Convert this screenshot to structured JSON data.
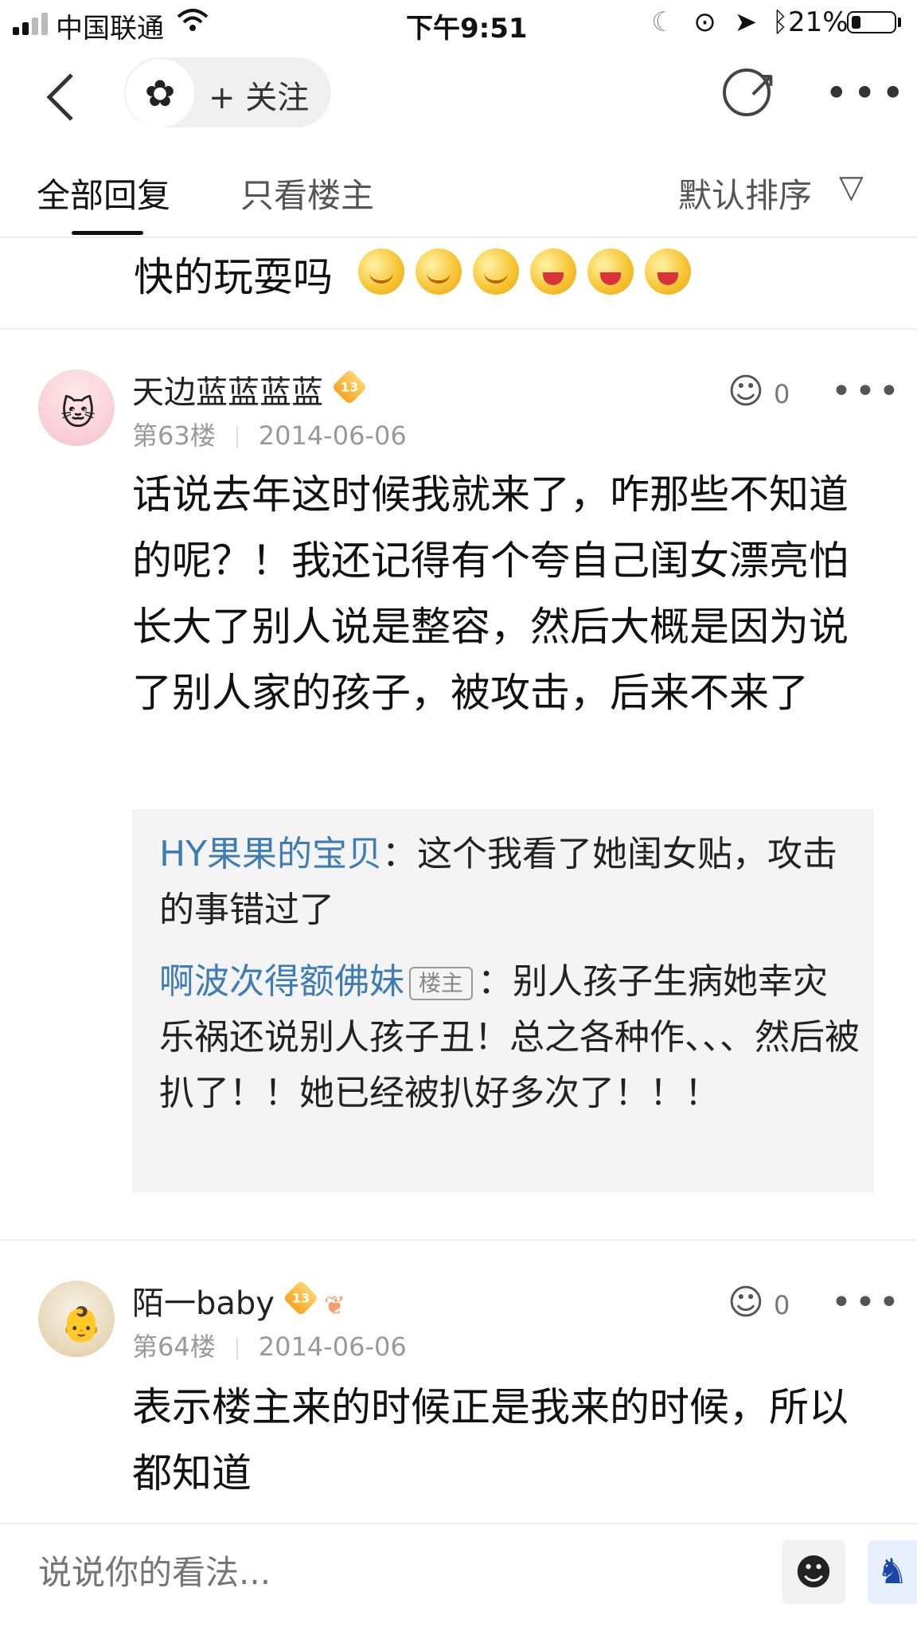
{
  "status_bar": {
    "carrier": "中国联通",
    "time": "下午9:51",
    "battery_percent": "21%",
    "battery_level": 0.21,
    "icons": [
      "moon-icon",
      "orientation-lock-icon",
      "location-icon",
      "bluetooth-icon"
    ]
  },
  "nav": {
    "back_icon": "chevron-left-icon",
    "follow_label": "+ 关注",
    "share_icon": "share-icon",
    "more_icon": "more-icon"
  },
  "tabs": {
    "all_replies": "全部回复",
    "owner_only": "只看楼主",
    "sort_label": "默认排序",
    "filter_icon": "filter-icon"
  },
  "previous_post": {
    "tail_text": "快的玩耍吗",
    "emojis": [
      "smile-emoji",
      "smile-emoji",
      "smile-emoji",
      "laugh-emoji",
      "laugh-emoji",
      "laugh-emoji"
    ]
  },
  "posts": [
    {
      "username": "天边蓝蓝蓝蓝",
      "level": "13",
      "floor": "第63楼",
      "date": "2014-06-06",
      "likes": "0",
      "content": "话说去年这时候我就来了，咋那些不知道的呢？！我还记得有个夸自己闺女漂亮怕长大了别人说是整容，然后大概是因为说了别人家的孩子，被攻击，后来不来了",
      "replies": [
        {
          "user": "HY果果的宝贝",
          "tag": "",
          "separator": "：",
          "text": "这个我看了她闺女贴，攻击的事错过了"
        },
        {
          "user": "啊波次得额佛妹",
          "tag": "楼主",
          "separator": "：",
          "text": "别人孩子生病她幸灾乐祸还说别人孩子丑！总之各种作、、、然后被扒了！！她已经被扒好多次了！！！"
        }
      ]
    },
    {
      "username": "陌一baby",
      "level": "13",
      "floor": "第64楼",
      "date": "2014-06-06",
      "likes": "0",
      "content": "表示楼主来的时候正是我来的时候，所以都知道"
    }
  ],
  "comment_bar": {
    "placeholder": "说说你的看法..."
  },
  "colors": {
    "link_blue": "#3e7cb5",
    "badge_gold": "#f5a623",
    "quote_bg": "#f4f4f4"
  }
}
